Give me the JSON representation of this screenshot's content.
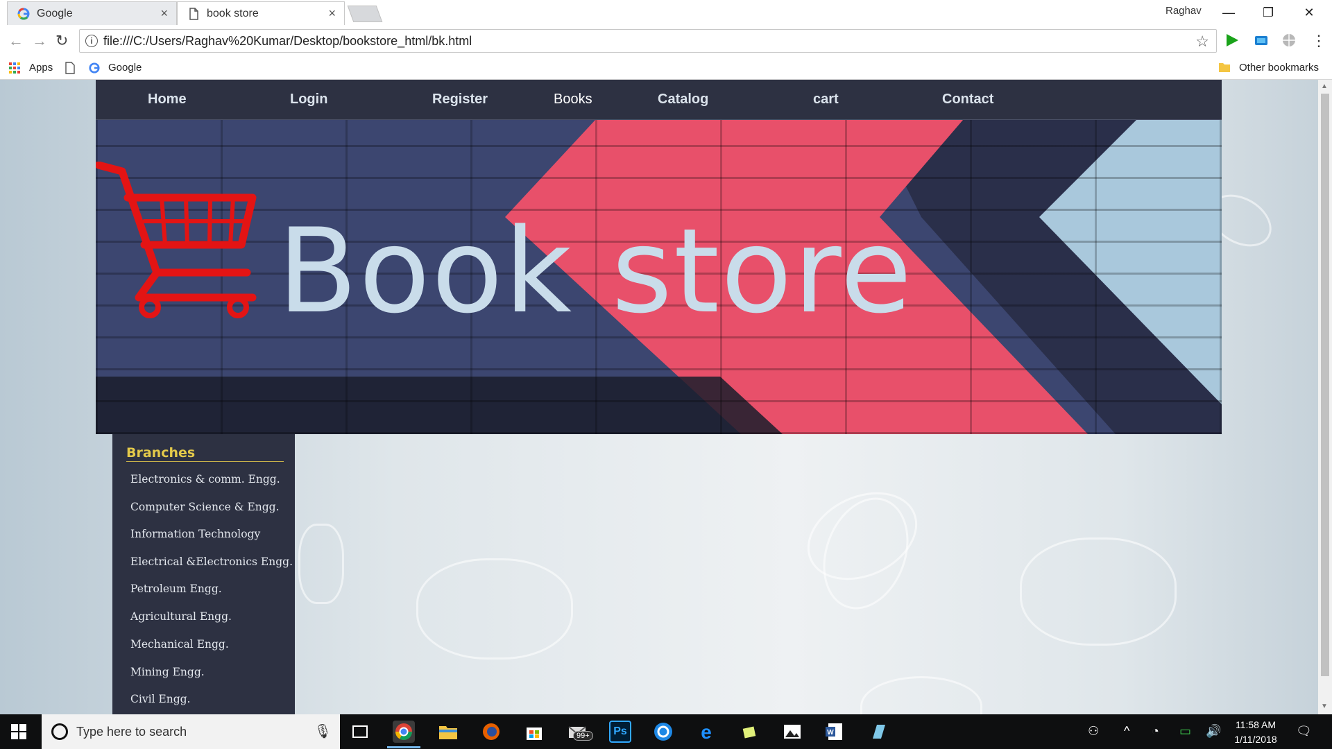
{
  "browser": {
    "tabs": [
      {
        "title": "Google"
      },
      {
        "title": "book store"
      }
    ],
    "user": "Raghav",
    "url": "file:///C:/Users/Raghav%20Kumar/Desktop/bookstore_html/bk.html",
    "bookmarks": {
      "apps": "Apps",
      "google": "Google",
      "other": "Other bookmarks"
    },
    "controls": {
      "minimize": "—",
      "restore": "❐",
      "close": "✕",
      "tab_close": "×"
    }
  },
  "site": {
    "nav": [
      "Home",
      "Login",
      "Register",
      "Books",
      "Catalog",
      "cart",
      "Contact"
    ],
    "banner_title": "Book store",
    "sidebar": {
      "heading": "Branches",
      "items": [
        "Electronics & comm. Engg.",
        "Computer Science & Engg.",
        "Information Technology",
        "Electrical &Electronics Engg.",
        "Petroleum Engg.",
        "Agricultural Engg.",
        "Mechanical Engg.",
        "Mining Engg.",
        "Civil Engg."
      ]
    }
  },
  "taskbar": {
    "search_placeholder": "Type here to search",
    "time": "11:58 AM",
    "date": "1/11/2018",
    "mail_badge": "99+"
  },
  "colors": {
    "nav_bg": "#2d3142",
    "nav_text": "#dbe3ec",
    "banner_text": "#c9dcea",
    "cart_red": "#e31414",
    "stripe_pink": "#e8506a",
    "sidebar_heading": "#e3c94a"
  }
}
